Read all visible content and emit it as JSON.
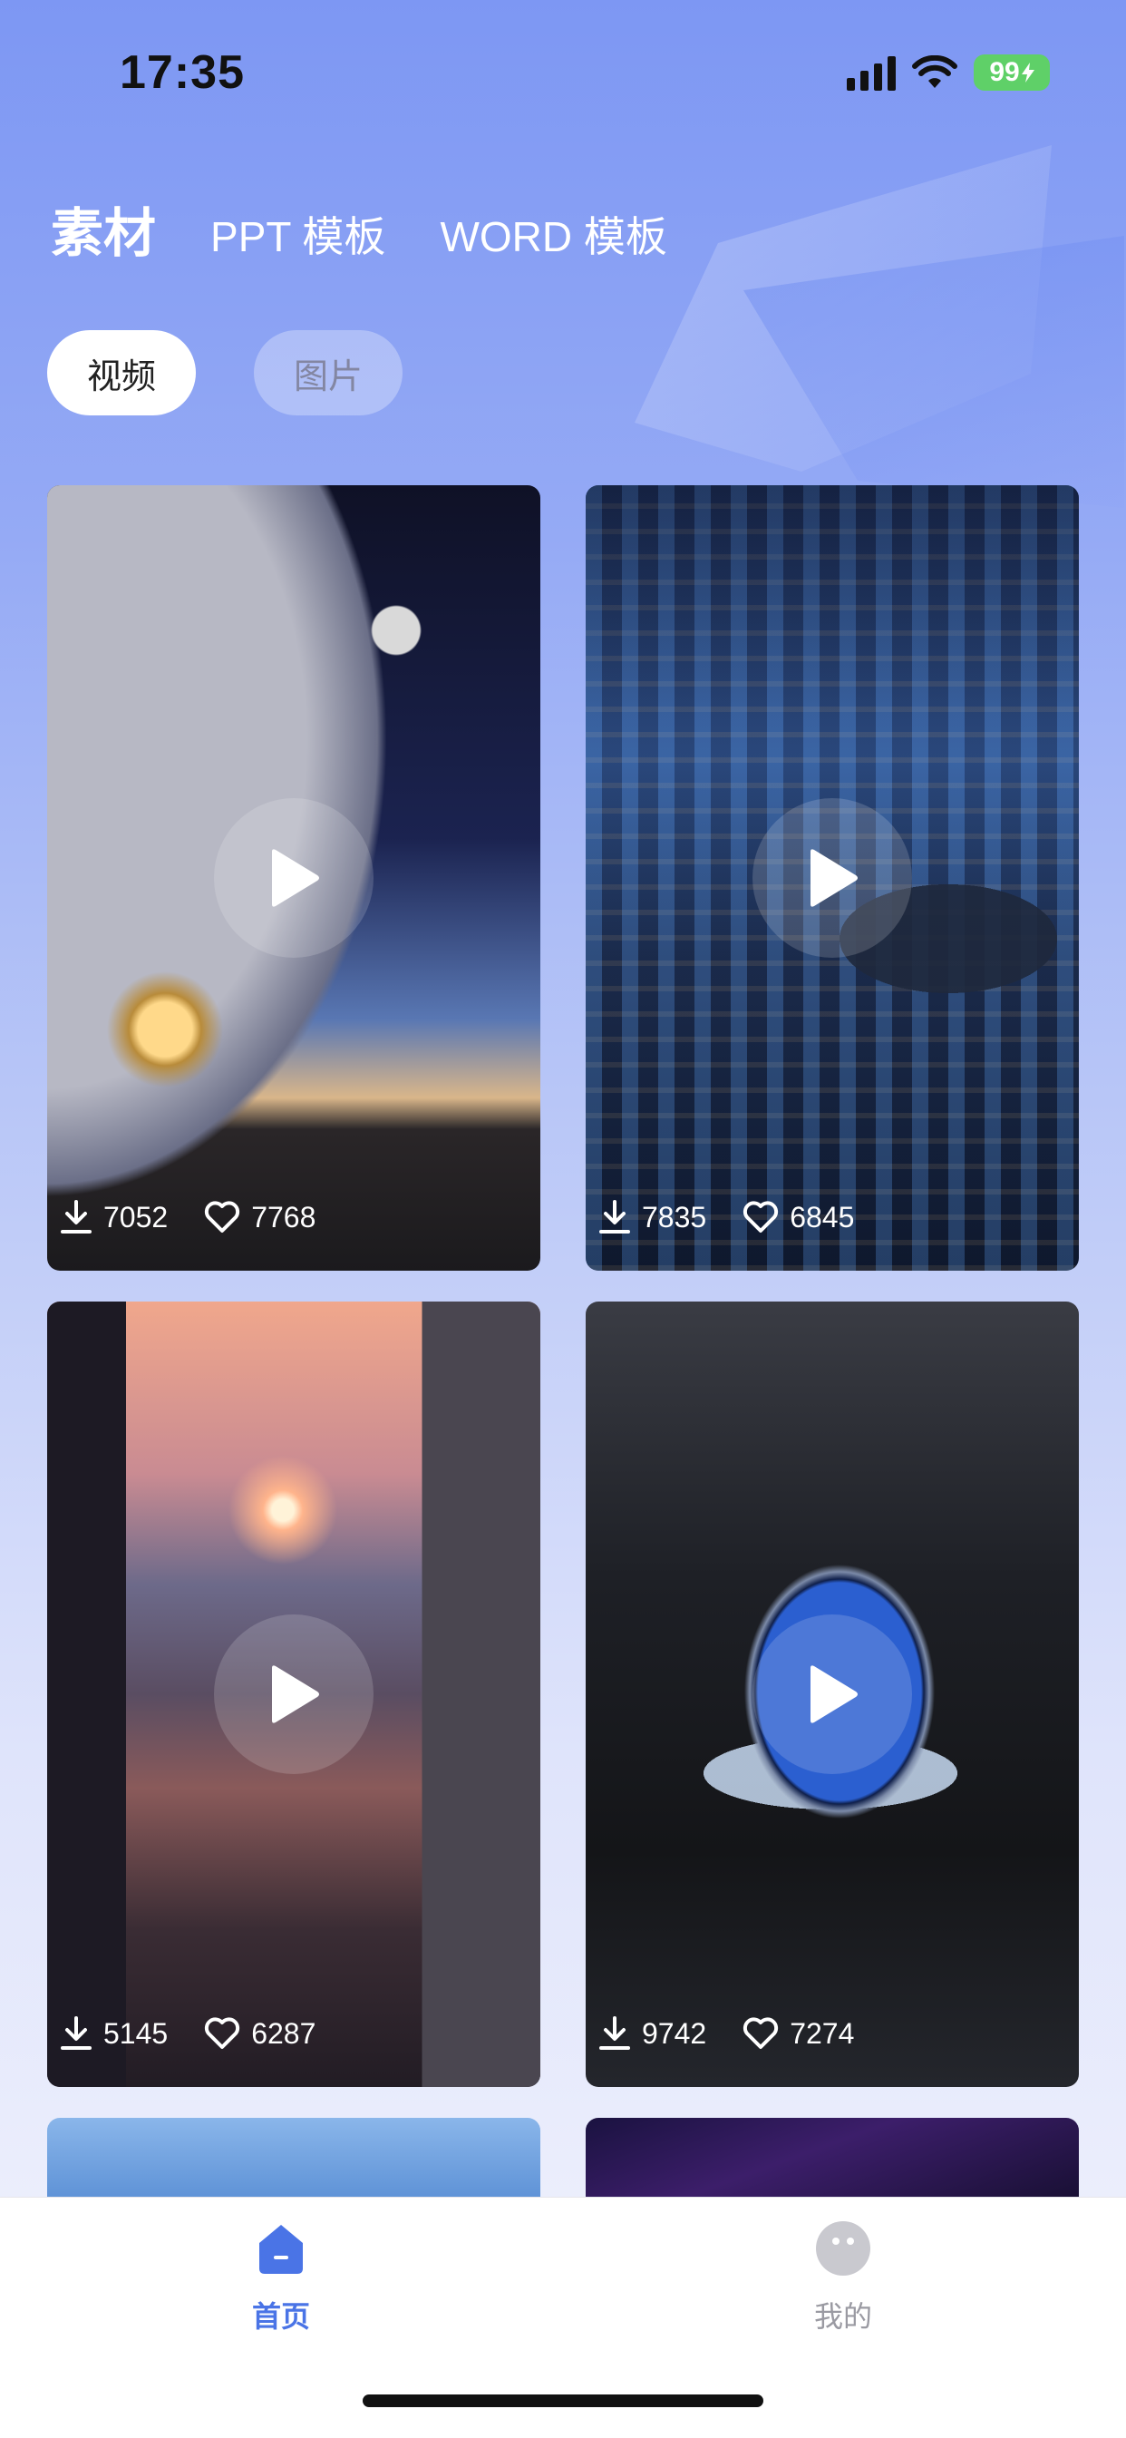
{
  "status_bar": {
    "time": "17:35",
    "battery": "99"
  },
  "top_tabs": [
    {
      "label": "素材",
      "active": true
    },
    {
      "label": "PPT 模板",
      "active": false
    },
    {
      "label": "WORD 模板",
      "active": false
    }
  ],
  "filter_chips": [
    {
      "label": "视频",
      "active": true
    },
    {
      "label": "图片",
      "active": false
    }
  ],
  "cards": [
    {
      "downloads": "7052",
      "likes": "7768"
    },
    {
      "downloads": "7835",
      "likes": "6845"
    },
    {
      "downloads": "5145",
      "likes": "6287"
    },
    {
      "downloads": "9742",
      "likes": "7274"
    }
  ],
  "tab_bar": {
    "home": {
      "label": "首页",
      "color": "#4a74e6"
    },
    "mine": {
      "label": "我的",
      "color": "#9a9aa2"
    }
  },
  "icons": {
    "download": "download-icon",
    "like": "heart-icon",
    "play": "play-icon"
  }
}
